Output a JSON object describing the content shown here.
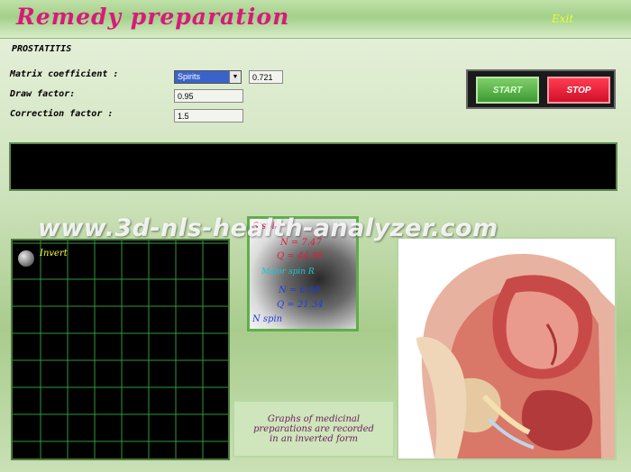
{
  "header": {
    "title": "Remedy preparation",
    "exit_label": "Exit"
  },
  "subtitle": "PROSTATITIS",
  "form": {
    "matrix_label": "Matrix coefficient :",
    "matrix_select_value": "Spirits",
    "matrix_value": "0.721",
    "draw_label": "Draw factor:",
    "draw_value": "0.95",
    "correction_label": "Correction factor :",
    "correction_value": "1.5"
  },
  "buttons": {
    "start": "START",
    "stop": "STOP"
  },
  "graph": {
    "invert_label": "Invert"
  },
  "info": {
    "line1": "S spin",
    "line2": "N = 7.47",
    "line3": "Q = 44.88",
    "line4": "Major spin R",
    "line5": "N = 6.49",
    "line6": "Q = 21.34",
    "line7": "N spin"
  },
  "caption": {
    "line1": "Graphs of medicinal",
    "line2": "preparations are recorded",
    "line3": "in an inverted form"
  },
  "watermark": "www.3d-nls-health-analyzer.com",
  "colors": {
    "title": "#d81a7a",
    "exit": "#e6ff33",
    "grid": "#2f9a3a",
    "start": "#3f9a35",
    "stop": "#d0102a"
  }
}
